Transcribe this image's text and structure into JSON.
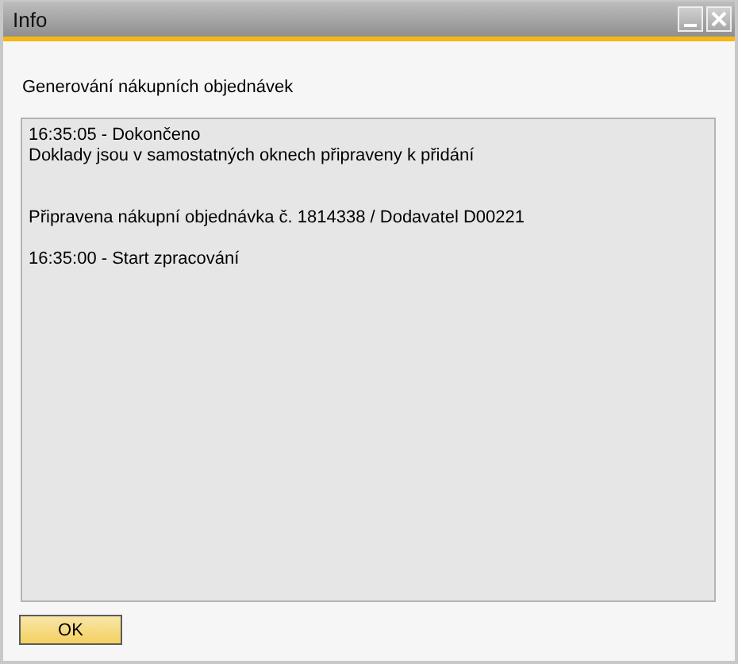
{
  "window": {
    "title": "Info"
  },
  "heading": "Generování nákupních objednávek",
  "log": "16:35:05 - Dokončeno\nDoklady jsou v samostatných oknech připraveny k přidání\n\n\nPřipravena nákupní objednávka č. 1814338 / Dodavatel D00221\n\n16:35:00 - Start zpracování",
  "buttons": [
    {
      "label": "OK"
    }
  ]
}
